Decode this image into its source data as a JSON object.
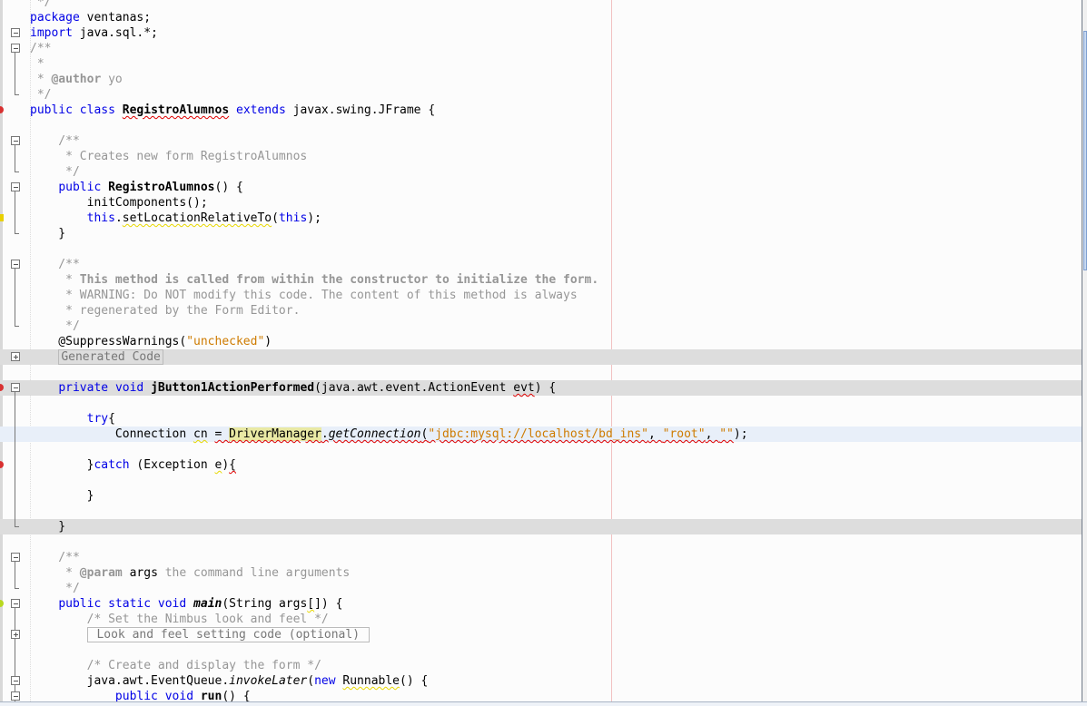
{
  "editor": {
    "colors": {
      "keyword": "#0000e6",
      "comment": "#969696",
      "string": "#ce7b00",
      "highlight": "#e9e9a4",
      "current_line": "#e8eff9",
      "folded_band": "#dddddd"
    },
    "lines": [
      {
        "tokens": [
          [
            " */",
            "cm"
          ]
        ],
        "fold": ""
      },
      {
        "tokens": [
          [
            "package",
            "kw"
          ],
          [
            " ventanas;",
            ""
          ]
        ],
        "fold": ""
      },
      {
        "tokens": [
          [
            "import",
            "kw"
          ],
          [
            " java.sql.*;",
            ""
          ]
        ],
        "fold": "open-single"
      },
      {
        "tokens": [
          [
            "/**",
            "cm"
          ]
        ],
        "fold": "open"
      },
      {
        "tokens": [
          [
            " *",
            "cm"
          ]
        ],
        "fold": "mid"
      },
      {
        "tokens": [
          [
            " * ",
            "cm"
          ],
          [
            "@author",
            "cmb"
          ],
          [
            " yo",
            "cm"
          ]
        ],
        "fold": "mid"
      },
      {
        "tokens": [
          [
            " */",
            "cm"
          ]
        ],
        "fold": "end"
      },
      {
        "tokens": [
          [
            "public",
            "kw"
          ],
          [
            " ",
            ""
          ],
          [
            "class",
            "kw"
          ],
          [
            " ",
            ""
          ],
          [
            "RegistroAlumnos",
            "b err"
          ],
          [
            " ",
            ""
          ],
          [
            "extends",
            "kw"
          ],
          [
            " javax.swing.JFrame {",
            ""
          ]
        ],
        "fold": "",
        "marker": "error"
      },
      {
        "tokens": [],
        "fold": ""
      },
      {
        "tokens": [
          [
            "    /**",
            "cm"
          ]
        ],
        "fold": "open"
      },
      {
        "tokens": [
          [
            "     * Creates new form RegistroAlumnos",
            "cm"
          ]
        ],
        "fold": "mid"
      },
      {
        "tokens": [
          [
            "     */",
            "cm"
          ]
        ],
        "fold": "end"
      },
      {
        "tokens": [
          [
            "    ",
            ""
          ],
          [
            "public",
            "kw"
          ],
          [
            " ",
            ""
          ],
          [
            "RegistroAlumnos",
            "b"
          ],
          [
            "() {",
            ""
          ]
        ],
        "fold": "open"
      },
      {
        "tokens": [
          [
            "        initComponents();",
            ""
          ]
        ],
        "fold": "mid"
      },
      {
        "tokens": [
          [
            "        ",
            ""
          ],
          [
            "this",
            "kw"
          ],
          [
            ".",
            ""
          ],
          [
            "setLocationRelativeTo",
            "warn"
          ],
          [
            "(",
            ""
          ],
          [
            "this",
            "kw"
          ],
          [
            ");",
            ""
          ]
        ],
        "fold": "mid",
        "marker": "warning"
      },
      {
        "tokens": [
          [
            "    }",
            ""
          ]
        ],
        "fold": "end"
      },
      {
        "tokens": [],
        "fold": ""
      },
      {
        "tokens": [
          [
            "    /**",
            "cm"
          ]
        ],
        "fold": "open"
      },
      {
        "tokens": [
          [
            "     * ",
            "cm"
          ],
          [
            "This method is called from within the constructor to initialize the form.",
            "cmb"
          ]
        ],
        "fold": "mid"
      },
      {
        "tokens": [
          [
            "     * WARNING: Do NOT modify this code. The content of this method is always",
            "cm"
          ]
        ],
        "fold": "mid"
      },
      {
        "tokens": [
          [
            "     * regenerated by the Form Editor.",
            "cm"
          ]
        ],
        "fold": "mid"
      },
      {
        "tokens": [
          [
            "     */",
            "cm"
          ]
        ],
        "fold": "end"
      },
      {
        "tokens": [
          [
            "    @SuppressWarnings(",
            ""
          ],
          [
            "\"unchecked\"",
            "str"
          ],
          [
            ")",
            ""
          ]
        ],
        "fold": ""
      },
      {
        "tokens": [
          [
            "    ",
            ""
          ],
          [
            "Generated Code",
            "box"
          ]
        ],
        "fold": "plus",
        "band": "gray"
      },
      {
        "tokens": [],
        "fold": ""
      },
      {
        "tokens": [
          [
            "    ",
            ""
          ],
          [
            "private",
            "kw"
          ],
          [
            " ",
            ""
          ],
          [
            "void",
            "kw"
          ],
          [
            " ",
            ""
          ],
          [
            "jButton1ActionPerformed",
            "b"
          ],
          [
            "(java.awt.event.ActionEvent ",
            ""
          ],
          [
            "evt",
            "err"
          ],
          [
            ") {",
            ""
          ]
        ],
        "fold": "open",
        "band": "gray",
        "marker": "error"
      },
      {
        "tokens": [],
        "fold": "mid"
      },
      {
        "tokens": [
          [
            "        ",
            ""
          ],
          [
            "try",
            "kw"
          ],
          [
            "{",
            ""
          ]
        ],
        "fold": "mid"
      },
      {
        "tokens": [
          [
            "            Connection ",
            ""
          ],
          [
            "cn",
            "warn"
          ],
          [
            " ",
            ""
          ],
          [
            "= ",
            "err"
          ],
          [
            "DriverManager",
            "hl err"
          ],
          [
            ".",
            "err"
          ],
          [
            "getConnection",
            "it err"
          ],
          [
            "(",
            "err"
          ],
          [
            "\"jdbc:mysql://localhost/bd_ins\"",
            "str err"
          ],
          [
            ", ",
            "err"
          ],
          [
            "\"root\"",
            "str err"
          ],
          [
            ", ",
            "err"
          ],
          [
            "\"\"",
            "str err"
          ],
          [
            ");",
            ""
          ]
        ],
        "fold": "mid",
        "band": "cur"
      },
      {
        "tokens": [],
        "fold": "mid"
      },
      {
        "tokens": [
          [
            "        }",
            ""
          ],
          [
            "catch",
            "kw"
          ],
          [
            " (Exception ",
            ""
          ],
          [
            "e",
            "warn"
          ],
          [
            ")",
            ""
          ],
          [
            "{",
            "err"
          ]
        ],
        "fold": "mid",
        "marker": "error"
      },
      {
        "tokens": [],
        "fold": "mid"
      },
      {
        "tokens": [
          [
            "        }",
            ""
          ]
        ],
        "fold": "mid"
      },
      {
        "tokens": [],
        "fold": "mid"
      },
      {
        "tokens": [
          [
            "    }",
            ""
          ]
        ],
        "fold": "end",
        "band": "gray"
      },
      {
        "tokens": [],
        "fold": ""
      },
      {
        "tokens": [
          [
            "    /**",
            "cm"
          ]
        ],
        "fold": "open"
      },
      {
        "tokens": [
          [
            "     * ",
            "cm"
          ],
          [
            "@param",
            "cmb"
          ],
          [
            " args",
            "cmt"
          ],
          [
            " the command line arguments",
            "cm"
          ]
        ],
        "fold": "mid"
      },
      {
        "tokens": [
          [
            "     */",
            "cm"
          ]
        ],
        "fold": "end"
      },
      {
        "tokens": [
          [
            "    ",
            ""
          ],
          [
            "public",
            "kw"
          ],
          [
            " ",
            ""
          ],
          [
            "static",
            "kw"
          ],
          [
            " ",
            ""
          ],
          [
            "void",
            "kw"
          ],
          [
            " ",
            ""
          ],
          [
            "main",
            "bi"
          ],
          [
            "(String args",
            ""
          ],
          [
            "[",
            "warn"
          ],
          [
            "]) {",
            ""
          ]
        ],
        "fold": "open",
        "marker": "ok"
      },
      {
        "tokens": [
          [
            "        /* Set the Nimbus look and feel */",
            "cm"
          ]
        ],
        "fold": "mid"
      },
      {
        "tokens": [
          [
            "        ",
            ""
          ],
          [
            " Look and feel setting code (optional) ",
            "box"
          ]
        ],
        "fold": "plus-mid"
      },
      {
        "tokens": [],
        "fold": "mid"
      },
      {
        "tokens": [
          [
            "        /* Create and display the form */",
            "cm"
          ]
        ],
        "fold": "mid"
      },
      {
        "tokens": [
          [
            "        java.awt.EventQueue.",
            ""
          ],
          [
            "invokeLater",
            "it"
          ],
          [
            "(",
            ""
          ],
          [
            "new",
            "kw"
          ],
          [
            " ",
            ""
          ],
          [
            "Runnable",
            "warn"
          ],
          [
            "() {",
            ""
          ]
        ],
        "fold": "open-mid"
      },
      {
        "tokens": [
          [
            "            ",
            ""
          ],
          [
            "public",
            "kw"
          ],
          [
            " ",
            ""
          ],
          [
            "void",
            "kw"
          ],
          [
            " ",
            ""
          ],
          [
            "run",
            "b warn"
          ],
          [
            "() {",
            ""
          ]
        ],
        "fold": "open-mid"
      }
    ]
  }
}
